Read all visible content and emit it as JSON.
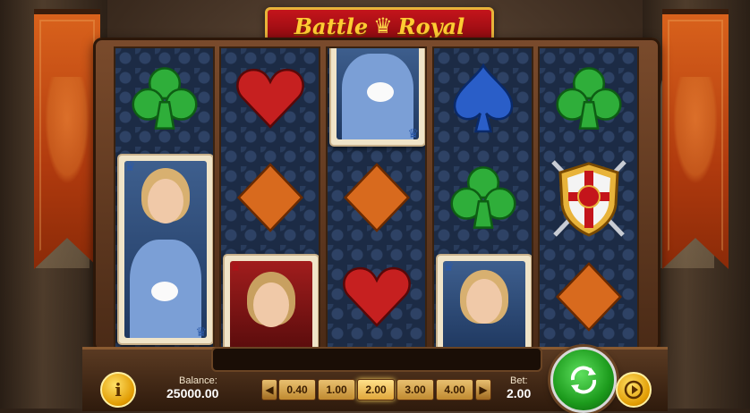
{
  "game": {
    "title_word1": "Battle",
    "title_word2": "Royal"
  },
  "reels": [
    [
      "club",
      "queen-rabbit-card"
    ],
    [
      "heart",
      "diamond",
      "queen-red-card"
    ],
    [
      "queen-rabbit-card",
      "diamond",
      "heart"
    ],
    [
      "spade",
      "club",
      "queen-blue-card"
    ],
    [
      "club",
      "shield-wild",
      "diamond"
    ]
  ],
  "controls": {
    "info_label": "i",
    "balance_label": "Balance:",
    "balance_value": "25000.00",
    "bet_options": [
      "0.40",
      "1.00",
      "2.00",
      "3.00",
      "4.00"
    ],
    "bet_selected": "2.00",
    "bet_label": "Bet:",
    "bet_value": "2.00"
  },
  "colors": {
    "club": "#1f9a2a",
    "heart": "#c4141b",
    "spade": "#1f4fb0",
    "diamond": "#d2691e",
    "banner": "#c4481a",
    "title_bg": "#b01018",
    "gold": "#e8b33a",
    "spin_green": "#1c9a1c"
  }
}
